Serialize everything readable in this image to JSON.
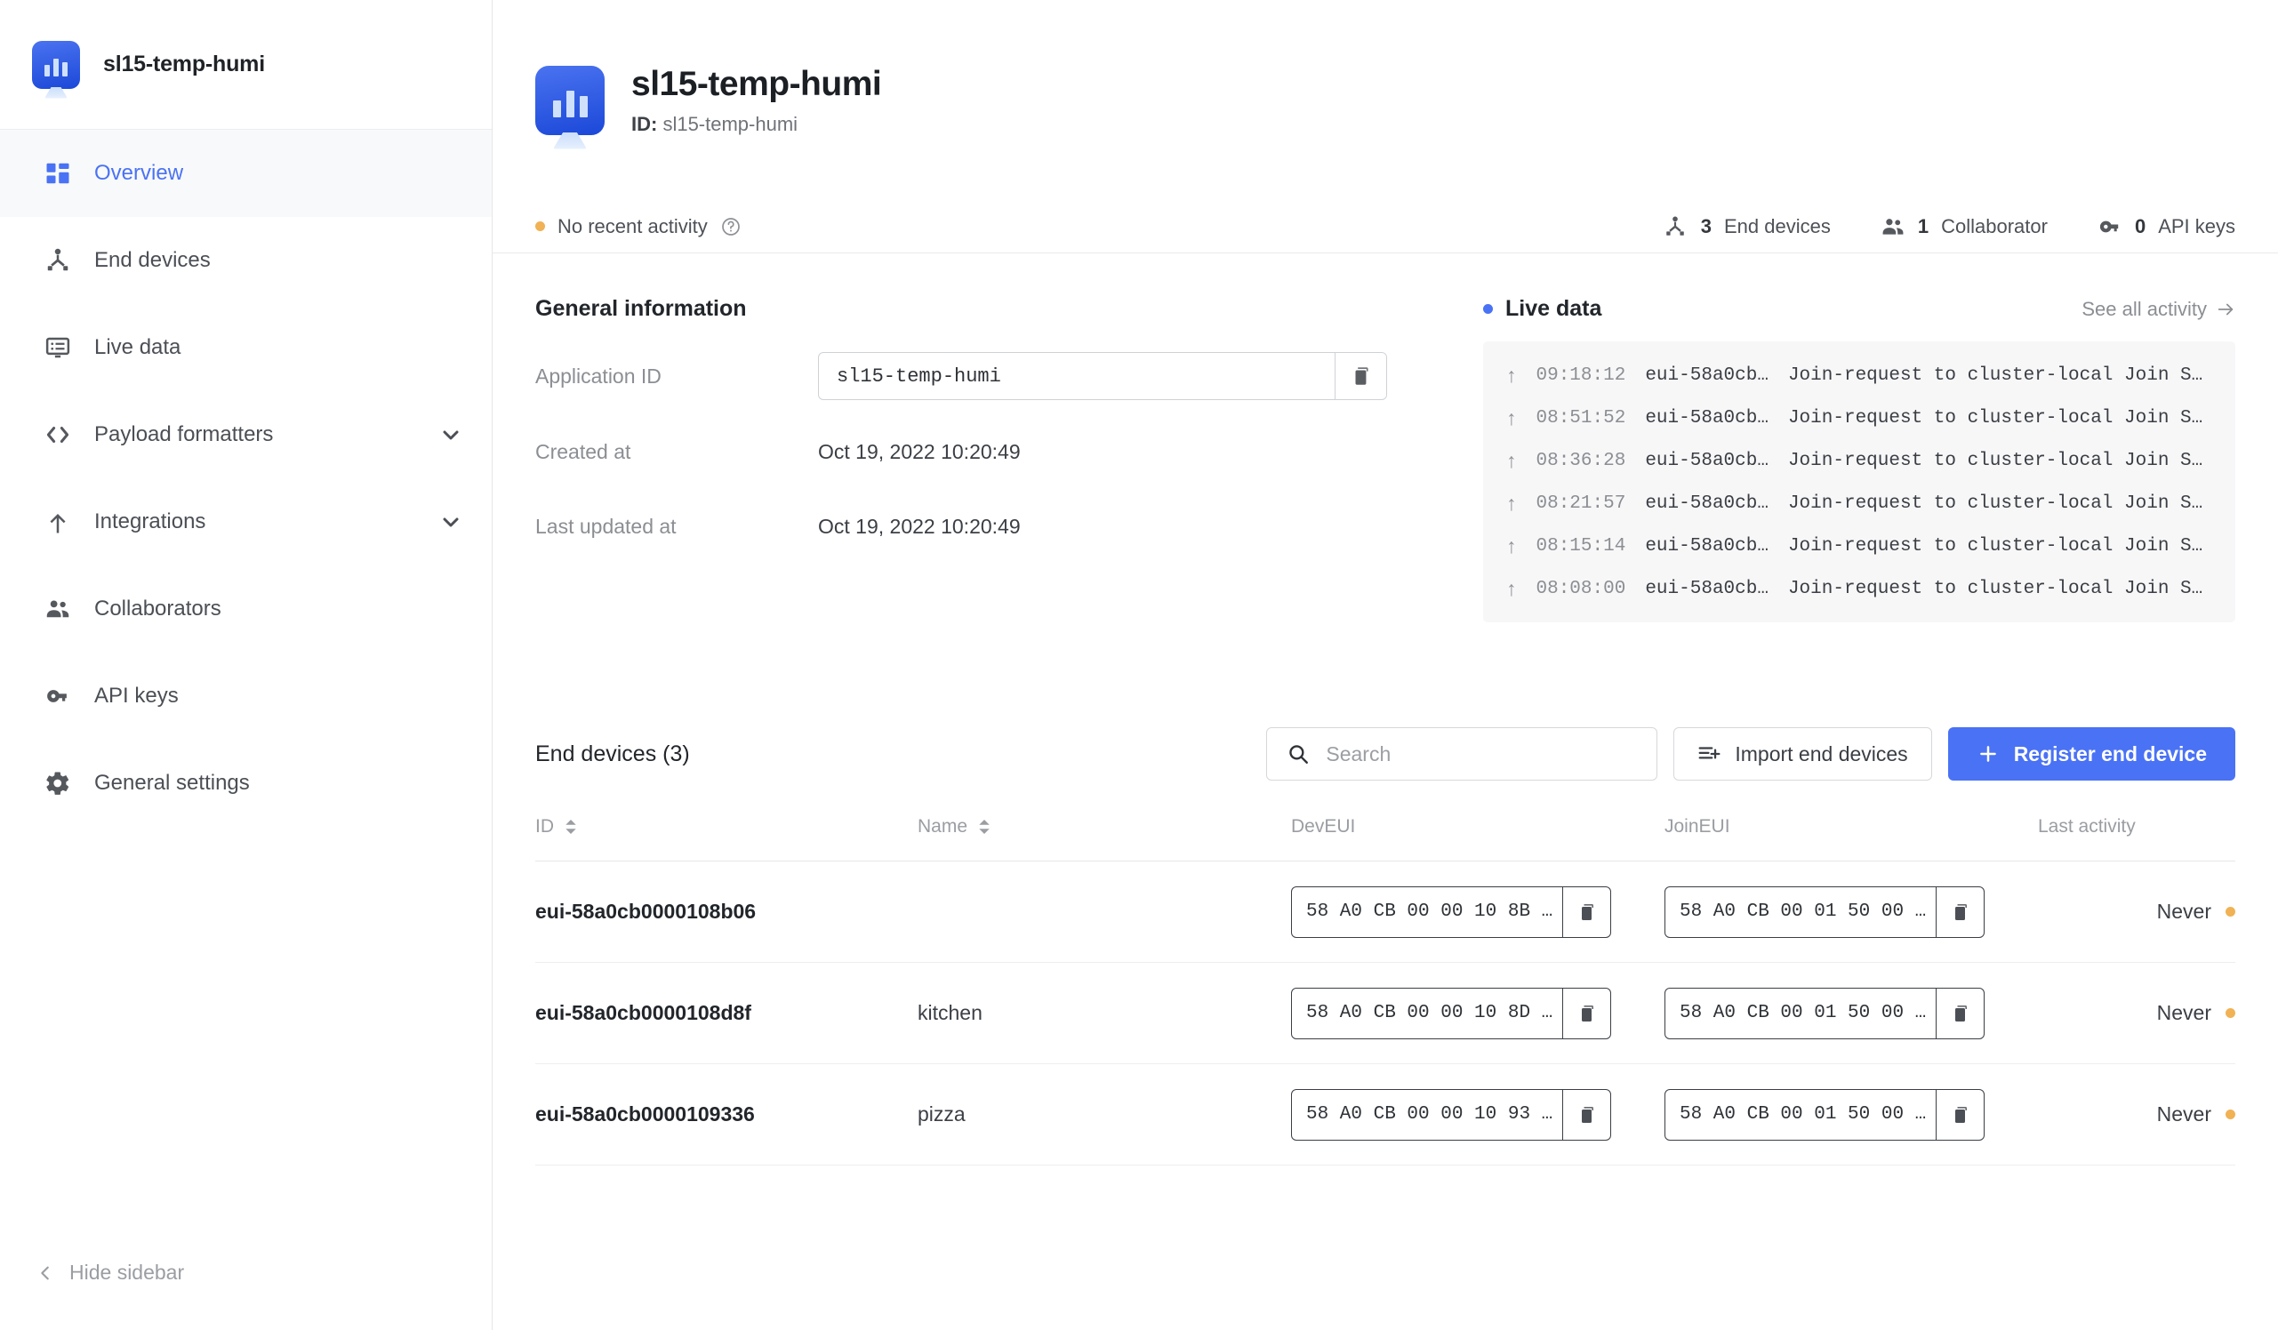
{
  "sidebar": {
    "app_name": "sl15-temp-humi",
    "app_icon": "application-tile-icon",
    "items": [
      {
        "label": "Overview",
        "icon": "grid-icon",
        "active": true,
        "expandable": false
      },
      {
        "label": "End devices",
        "icon": "end-device-icon",
        "active": false,
        "expandable": false
      },
      {
        "label": "Live data",
        "icon": "live-data-icon",
        "active": false,
        "expandable": false
      },
      {
        "label": "Payload formatters",
        "icon": "code-brackets-icon",
        "active": false,
        "expandable": true
      },
      {
        "label": "Integrations",
        "icon": "integrations-icon",
        "active": false,
        "expandable": true
      },
      {
        "label": "Collaborators",
        "icon": "collaborators-icon",
        "active": false,
        "expandable": false
      },
      {
        "label": "API keys",
        "icon": "key-icon",
        "active": false,
        "expandable": false
      },
      {
        "label": "General settings",
        "icon": "gear-icon",
        "active": false,
        "expandable": false
      }
    ],
    "hide_sidebar_label": "Hide sidebar",
    "hide_sidebar_icon": "chevron-left-icon"
  },
  "header": {
    "title": "sl15-temp-humi",
    "id_label": "ID:",
    "id_value": "sl15-temp-humi"
  },
  "status": {
    "activity_text": "No recent activity",
    "activity_dot_color": "#f0b254",
    "help_icon": "question-circle-icon",
    "counters": [
      {
        "count": "3",
        "label": "End devices",
        "icon": "end-device-icon"
      },
      {
        "count": "1",
        "label": "Collaborator",
        "icon": "collaborators-icon"
      },
      {
        "count": "0",
        "label": "API keys",
        "icon": "key-icon"
      }
    ]
  },
  "general_information": {
    "section_title": "General information",
    "application_id_label": "Application ID",
    "application_id_value": "sl15-temp-humi",
    "copy_icon": "copy-icon",
    "created_at_label": "Created at",
    "created_at_value": "Oct 19, 2022 10:20:49",
    "last_updated_label": "Last updated at",
    "last_updated_value": "Oct 19, 2022 10:20:49"
  },
  "live_data": {
    "title": "Live data",
    "dot_color": "#4a72f5",
    "see_all_label": "See all activity",
    "see_all_icon": "arrow-right-icon",
    "rows": [
      {
        "direction": "uplink-arrow-icon",
        "time": "09:18:12",
        "device": "eui-58a0cb…",
        "message": "Join-request to cluster-local Join Se…"
      },
      {
        "direction": "uplink-arrow-icon",
        "time": "08:51:52",
        "device": "eui-58a0cb…",
        "message": "Join-request to cluster-local Join Se…"
      },
      {
        "direction": "uplink-arrow-icon",
        "time": "08:36:28",
        "device": "eui-58a0cb…",
        "message": "Join-request to cluster-local Join Se…"
      },
      {
        "direction": "uplink-arrow-icon",
        "time": "08:21:57",
        "device": "eui-58a0cb…",
        "message": "Join-request to cluster-local Join Se…"
      },
      {
        "direction": "uplink-arrow-icon",
        "time": "08:15:14",
        "device": "eui-58a0cb…",
        "message": "Join-request to cluster-local Join Se…"
      },
      {
        "direction": "uplink-arrow-icon",
        "time": "08:08:00",
        "device": "eui-58a0cb…",
        "message": "Join-request to cluster-local Join Se…"
      }
    ]
  },
  "end_devices": {
    "title": "End devices (3)",
    "search_placeholder": "Search",
    "search_value": "",
    "search_icon": "search-icon",
    "import_label": "Import end devices",
    "import_icon": "import-icon",
    "register_label": "Register end device",
    "register_icon": "plus-icon",
    "register_color": "#4a72f5",
    "columns": [
      {
        "label": "ID",
        "sortable": true
      },
      {
        "label": "Name",
        "sortable": true
      },
      {
        "label": "DevEUI",
        "sortable": false
      },
      {
        "label": "JoinEUI",
        "sortable": false
      },
      {
        "label": "Last activity",
        "sortable": false
      }
    ],
    "rows": [
      {
        "id": "eui-58a0cb0000108b06",
        "name": "",
        "dev_eui": "58 A0 CB 00 00 10 8B …",
        "join_eui": "58 A0 CB 00 01 50 00 …",
        "last_activity": "Never",
        "status_color": "#f0b254"
      },
      {
        "id": "eui-58a0cb0000108d8f",
        "name": "kitchen",
        "dev_eui": "58 A0 CB 00 00 10 8D …",
        "join_eui": "58 A0 CB 00 01 50 00 …",
        "last_activity": "Never",
        "status_color": "#f0b254"
      },
      {
        "id": "eui-58a0cb0000109336",
        "name": "pizza",
        "dev_eui": "58 A0 CB 00 00 10 93 …",
        "join_eui": "58 A0 CB 00 01 50 00 …",
        "last_activity": "Never",
        "status_color": "#f0b254"
      }
    ]
  }
}
